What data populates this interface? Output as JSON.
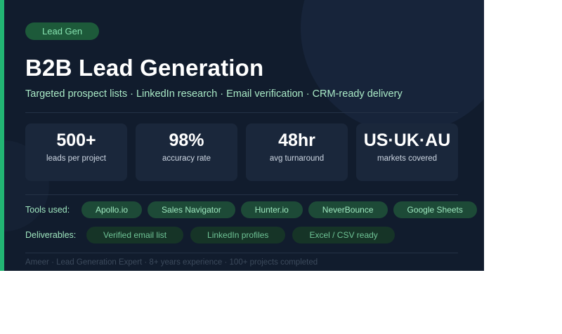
{
  "colors": {
    "background": "#111c2d",
    "accent": "#22b573",
    "card": "#1a273b",
    "chip": "#1d4a37",
    "text_green": "#a9e9c6"
  },
  "badge": "Lead Gen",
  "title": "B2B Lead Generation",
  "subtitle": "Targeted prospect lists · LinkedIn research · Email verification · CRM-ready delivery",
  "stats": [
    {
      "value": "500+",
      "label": "leads per project"
    },
    {
      "value": "98%",
      "label": "accuracy rate"
    },
    {
      "value": "48hr",
      "label": "avg turnaround"
    },
    {
      "value": "US·UK·AU",
      "label": "markets covered"
    }
  ],
  "tools": {
    "label": "Tools used:",
    "items": [
      "Apollo.io",
      "Sales Navigator",
      "Hunter.io",
      "NeverBounce",
      "Google Sheets"
    ]
  },
  "deliverables": {
    "label": "Deliverables:",
    "items": [
      "Verified email list",
      "LinkedIn profiles",
      "Excel / CSV ready"
    ]
  },
  "footer": "Ameer · Lead Generation Expert · 8+ years experience · 100+ projects completed"
}
